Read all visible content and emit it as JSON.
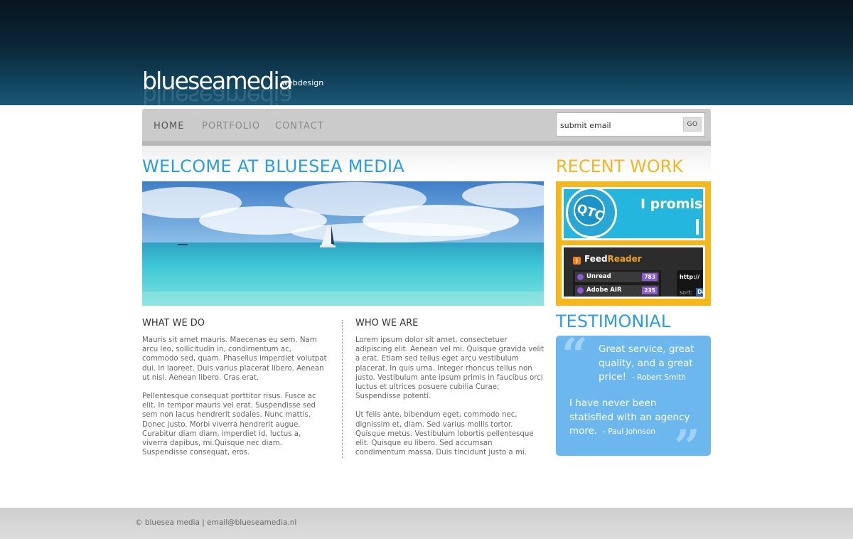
{
  "header": {
    "logo": "blueseamedia",
    "logo_sub": "webdesign"
  },
  "nav": {
    "items": [
      "HOME",
      "PORTFOLIO",
      "CONTACT"
    ],
    "active": "HOME"
  },
  "email": {
    "placeholder": "submit email",
    "go_label": "GO"
  },
  "main": {
    "welcome_title": "WELCOME AT BLUESEA MEDIA",
    "what_we_do": {
      "title": "WHAT WE DO",
      "paragraphs": [
        "Mauris sit amet mauris. Maecenas eu sem. Nam arcu leo, sollicitudin in, condimentum ac, commodo sed, quam. Phasellus imperdiet volutpat dui. In laoreet. Duis varius placerat libero. Aenean ut nisl. Aenean libero. Cras erat.",
        "Pellentesque consequat porttitor risus. Fusce ac elit. In tempor mauris vel erat. Suspendisse sed sem non lacus hendrerit sodales. Nunc mattis. Donec justo. Morbi viverra hendrerit augue. Curabitur diam diam, imperdiet id, luctus a, viverra dapibus, mi.Quisque nec diam. Suspendisse consequat, eros."
      ]
    },
    "who_we_are": {
      "title": "WHO WE ARE",
      "paragraphs": [
        "Lorem ipsum dolor sit amet, consectetuer adipiscing elit. Aenean vel mi. Quisque gravida velit a erat. Etiam sed tellus eget arcu vestibulum placerat. In quis urna. Integer rhoncus tellus non justo. Vestibulum ante ipsum primis in faucibus orci luctus et ultrices posuere cubilia Curae; Suspendisse potenti.",
        "Ut felis ante, bibendum eget, commodo nec, dignissim et, diam. Sed varius mollis tortor. Quisque metus. Vestibulum lobortis pellentesque elit. Quisque eu libero. Sed accumsan condimentum massa. Duis tincidunt justo a mi."
      ]
    }
  },
  "recent_work": {
    "title": "RECENT WORK",
    "thumb1": {
      "badge": "QTC",
      "headline": "I promise"
    },
    "thumb2": {
      "title_a": "Feed",
      "title_b": "Reader",
      "rows": [
        {
          "label": "Unread",
          "count": "783"
        },
        {
          "label": "Adobe AIR",
          "count": "235"
        }
      ],
      "side_a": "http://",
      "side_b": "sort:",
      "side_c": "Da"
    }
  },
  "testimonial": {
    "title": "TESTIMONIAL",
    "quotes": [
      {
        "text": "Great service, great quality, and a great price!",
        "author": "- Robert Smith"
      },
      {
        "text": "I have never been statisfied with an agency more.",
        "author": "- Paul Johnson"
      }
    ]
  },
  "footer": {
    "text": "© bluesea media | email@blueseamedia.nl"
  },
  "colors": {
    "accent_blue": "#2b9ee2",
    "accent_orange": "#f2b623",
    "testimonial_bg": "#6cb8ee",
    "header_dark": "#0b2737"
  }
}
